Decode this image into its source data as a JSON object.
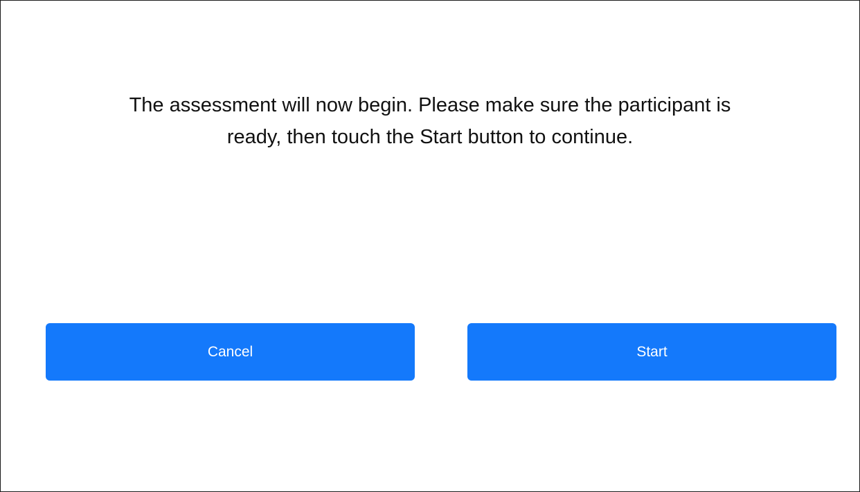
{
  "prompt": {
    "line1": "The assessment will now begin. Please make sure the participant is",
    "line2": "ready, then touch the Start button to continue."
  },
  "actions": {
    "cancel_label": "Cancel",
    "start_label": "Start"
  },
  "colors": {
    "button_background": "#1479fb",
    "text": "#111111",
    "border": "#1a1a1a"
  }
}
